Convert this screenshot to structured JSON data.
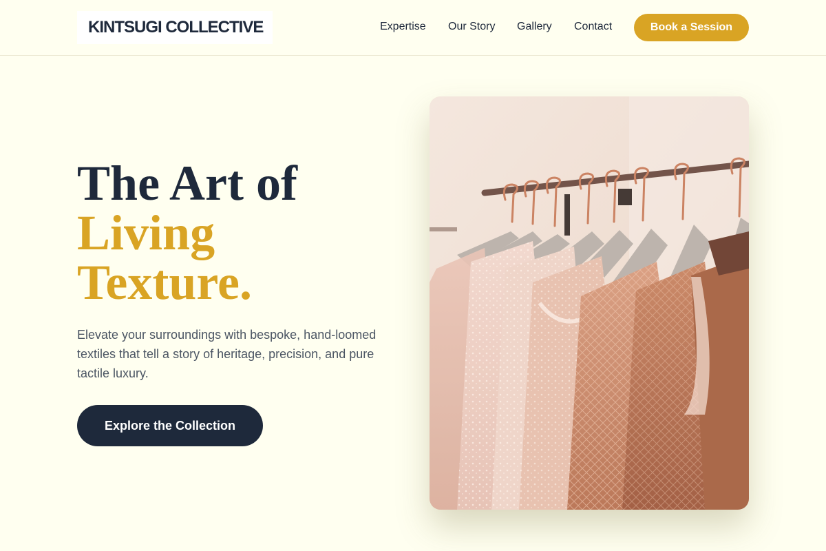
{
  "brand": {
    "name": "KINTSUGI COLLECTIVE"
  },
  "nav": {
    "items": [
      {
        "label": "Expertise"
      },
      {
        "label": "Our Story"
      },
      {
        "label": "Gallery"
      },
      {
        "label": "Contact"
      }
    ],
    "cta_label": "Book a Session"
  },
  "hero": {
    "title_line1": "The Art of",
    "title_line2": "Living",
    "title_line3": "Texture.",
    "subtitle": "Elevate your surroundings with bespoke, hand-loomed textiles that tell a story of heritage, precision, and pure tactile luxury.",
    "button_label": "Explore the Collection"
  },
  "colors": {
    "background": "#fffff0",
    "accent": "#d9a424",
    "navy": "#1e293b"
  },
  "image": {
    "subject": "clothing-rack-with-garments"
  }
}
